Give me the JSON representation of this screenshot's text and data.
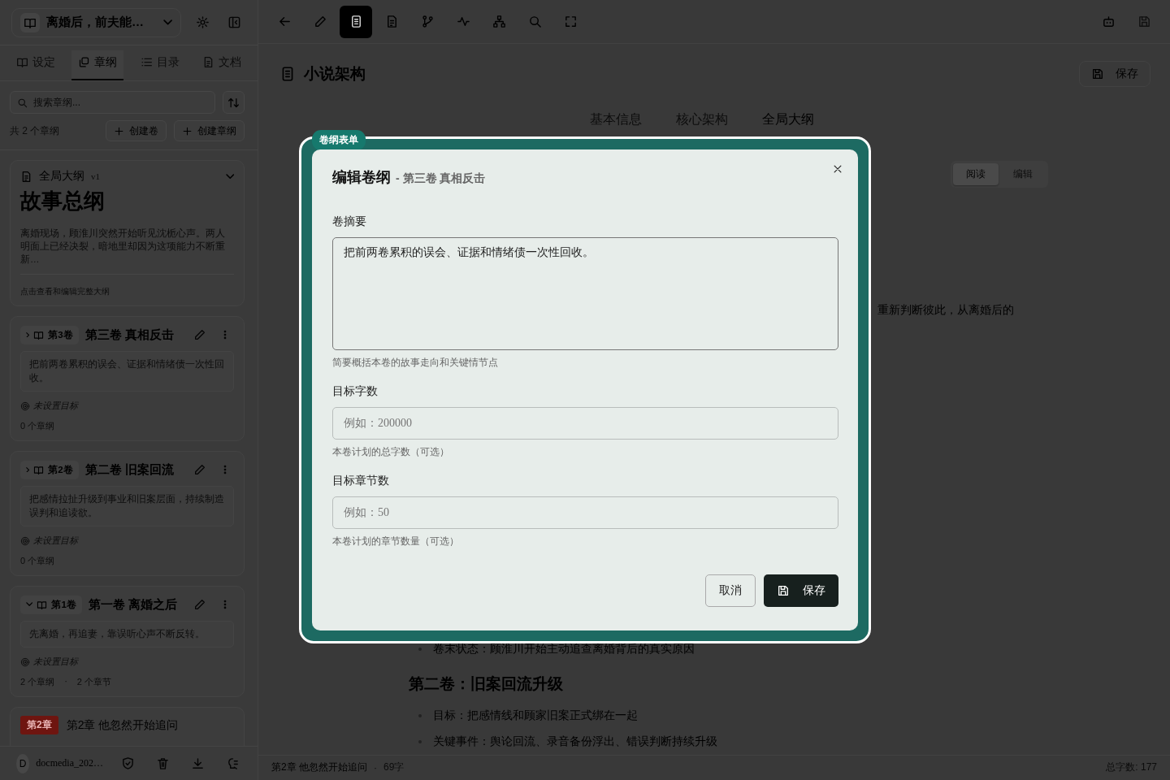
{
  "sidebar": {
    "project_title": "离婚后，前夫能…",
    "tabs": [
      {
        "label": "设定",
        "selected": false
      },
      {
        "label": "章纲",
        "selected": true
      },
      {
        "label": "目录",
        "selected": false
      },
      {
        "label": "文档",
        "selected": false
      }
    ],
    "search": {
      "placeholder": "搜索章纲..."
    },
    "count": "共 2 个章纲",
    "buttons": [
      "创建卷",
      "创建章纲"
    ],
    "outline_card": {
      "label": "全局大纲",
      "version": "v1",
      "title": "故事总纲",
      "summary": "离婚现场，顾淮川突然开始听见沈栀心声。两人明面上已经决裂，暗地里却因为这项能力不断重新…",
      "hint": "点击查看和编辑完整大纲"
    },
    "volumes": [
      {
        "badge": "第3卷",
        "title": "第三卷 真相反击",
        "summary": "把前两卷累积的误会、证据和情绪债一次性回收。",
        "target": "未设置目标",
        "counts": [
          "0 个章纲"
        ],
        "expanded": false
      },
      {
        "badge": "第2卷",
        "title": "第二卷 旧案回流",
        "summary": "把感情拉扯升级到事业和旧案层面，持续制造误判和追读欲。",
        "target": "未设置目标",
        "counts": [
          "0 个章纲"
        ],
        "expanded": false
      },
      {
        "badge": "第1卷",
        "title": "第一卷 离婚之后",
        "summary": "先离婚，再追妻，靠误听心声不断反转。",
        "target": "未设置目标",
        "counts": [
          "2 个章纲",
          "·",
          "2 个章节"
        ],
        "expanded": true
      }
    ],
    "chapter": {
      "badge": "第2章",
      "title": "第2章 他忽然开始追问"
    },
    "footer": {
      "avatar": "D",
      "user": "docmedia_202…"
    }
  },
  "toolbar": {
    "tools": [
      {
        "selected": false
      },
      {
        "selected": false
      },
      {
        "selected": true
      },
      {
        "selected": false
      },
      {
        "selected": false
      },
      {
        "selected": false
      },
      {
        "selected": false
      },
      {
        "selected": false
      },
      {
        "selected": false
      }
    ]
  },
  "header": {
    "title": "小说架构",
    "save": "保存"
  },
  "tabs": [
    {
      "label": "基本信息",
      "selected": false
    },
    {
      "label": "核心架构",
      "selected": false
    },
    {
      "label": "全局大纲",
      "selected": true
    }
  ],
  "view_toggle": [
    {
      "label": "阅读",
      "selected": true
    },
    {
      "label": "编辑",
      "selected": false
    }
  ],
  "content": {
    "fragment": "重新判断彼此，从离婚后的",
    "last_line": "卷末状态：顾淮川开始主动追查离婚背后的真实原因",
    "heading": "第二卷：旧案回流升级",
    "bullets": [
      "目标：把感情线和顾家旧案正式绑在一起",
      "关键事件：舆论回流、录音备份浮出、错误判断持续升级"
    ]
  },
  "status_bar": {
    "chapter": "第2章 他忽然开始追问",
    "separator": "·",
    "words": "69字",
    "total": "总字数: 177"
  },
  "dialog": {
    "badge": "卷纲表单",
    "title": "编辑卷纲",
    "subtitle": "- 第三卷 真相反击",
    "fields": [
      {
        "kind": "textarea",
        "label": "卷摘要",
        "value": "把前两卷累积的误会、证据和情绪债一次性回收。",
        "hint": "简要概括本卷的故事走向和关键情节点"
      },
      {
        "kind": "input",
        "label": "目标字数",
        "placeholder": "例如：200000",
        "hint": "本卷计划的总字数（可选）"
      },
      {
        "kind": "input",
        "label": "目标章节数",
        "placeholder": "例如：50",
        "hint": "本卷计划的章节数量（可选）"
      }
    ],
    "buttons": [
      {
        "kind": "secondary",
        "label": "取消"
      },
      {
        "kind": "primary",
        "label": "保存"
      }
    ]
  }
}
